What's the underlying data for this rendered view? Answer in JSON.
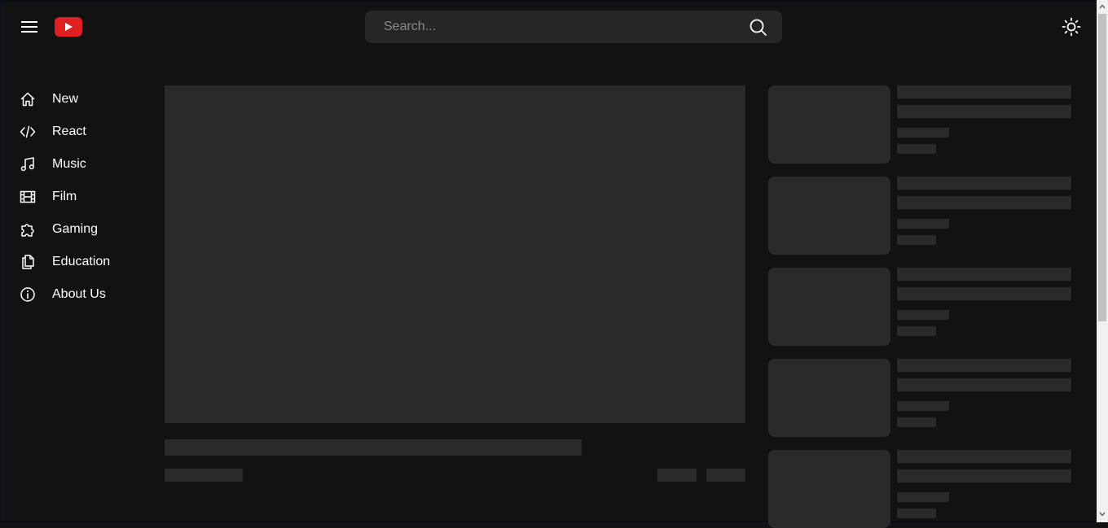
{
  "header": {
    "search": {
      "placeholder": "Search...",
      "value": ""
    },
    "icons": {
      "menu": "hamburger-menu-icon",
      "logo": "youtube-play-icon",
      "search": "magnifier-icon",
      "theme": "sun-icon"
    }
  },
  "sidebar": {
    "items": [
      {
        "label": "New",
        "icon": "home-icon"
      },
      {
        "label": "React",
        "icon": "code-icon"
      },
      {
        "label": "Music",
        "icon": "music-note-icon"
      },
      {
        "label": "Film",
        "icon": "film-icon"
      },
      {
        "label": "Gaming",
        "icon": "puzzle-icon"
      },
      {
        "label": "Education",
        "icon": "documents-icon"
      },
      {
        "label": "About Us",
        "icon": "info-icon"
      }
    ]
  },
  "colors": {
    "background": "#121212",
    "skeleton": "#2a2a2a",
    "search_bg": "#262626",
    "logo_red": "#e02020",
    "text": "#ffffff"
  }
}
